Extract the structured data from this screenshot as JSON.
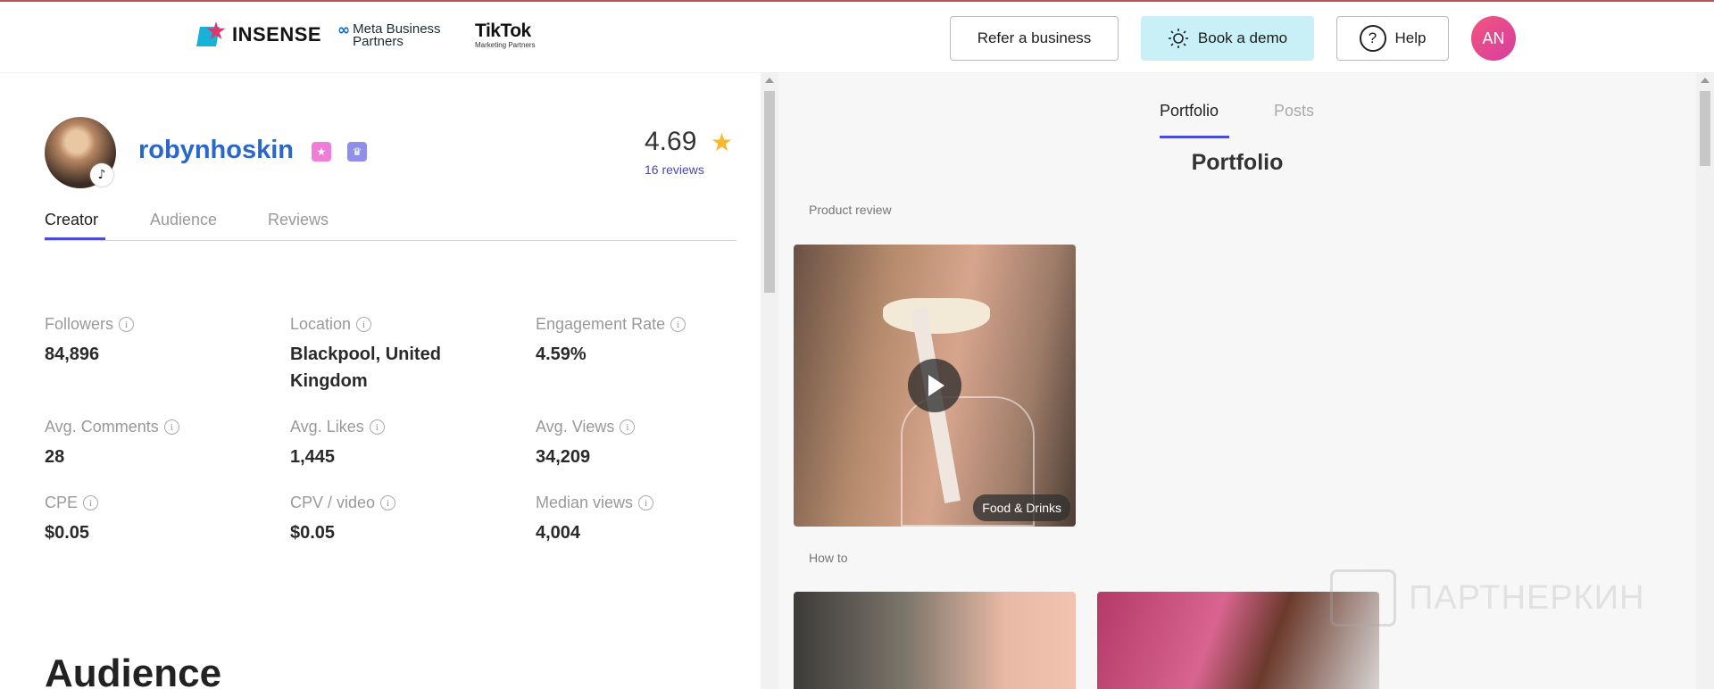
{
  "header": {
    "brand": "INSENSE",
    "partner_meta_symbol": "∞",
    "partner_meta_line1": "Meta Business",
    "partner_meta_line2": "Partners",
    "partner_tiktok": "TikTok",
    "partner_tiktok_sub": "Marketing Partners",
    "refer_label": "Refer a business",
    "demo_label": "Book a demo",
    "help_label": "Help",
    "help_icon": "?",
    "user_initials": "AN"
  },
  "profile": {
    "username": "robynhoskin",
    "rating": "4.69",
    "reviews": "16 reviews",
    "tabs": [
      "Creator",
      "Audience",
      "Reviews"
    ],
    "stats": [
      {
        "label": "Followers",
        "value": "84,896"
      },
      {
        "label": "Location",
        "value": "Blackpool, United Kingdom"
      },
      {
        "label": "Engagement Rate",
        "value": "4.59%"
      },
      {
        "label": "Avg. Comments",
        "value": "28"
      },
      {
        "label": "Avg. Likes",
        "value": "1,445"
      },
      {
        "label": "Avg. Views",
        "value": "34,209"
      },
      {
        "label": "CPE",
        "value": "$0.05"
      },
      {
        "label": "CPV / video",
        "value": "$0.05"
      },
      {
        "label": "Median views",
        "value": "4,004"
      }
    ],
    "info_glyph": "i",
    "audience_heading": "Audience"
  },
  "portfolio": {
    "tabs": [
      "Portfolio",
      "Posts"
    ],
    "title": "Portfolio",
    "sections": [
      {
        "label": "Product review",
        "tag": "Food & Drinks"
      },
      {
        "label": "How to"
      }
    ]
  },
  "watermark": "ПАРТНЕРКИН",
  "colors": {
    "accent": "#4b4bd6",
    "username": "#2b67c7",
    "demo_bg": "#c9f0f7",
    "star": "#f5b82e"
  }
}
